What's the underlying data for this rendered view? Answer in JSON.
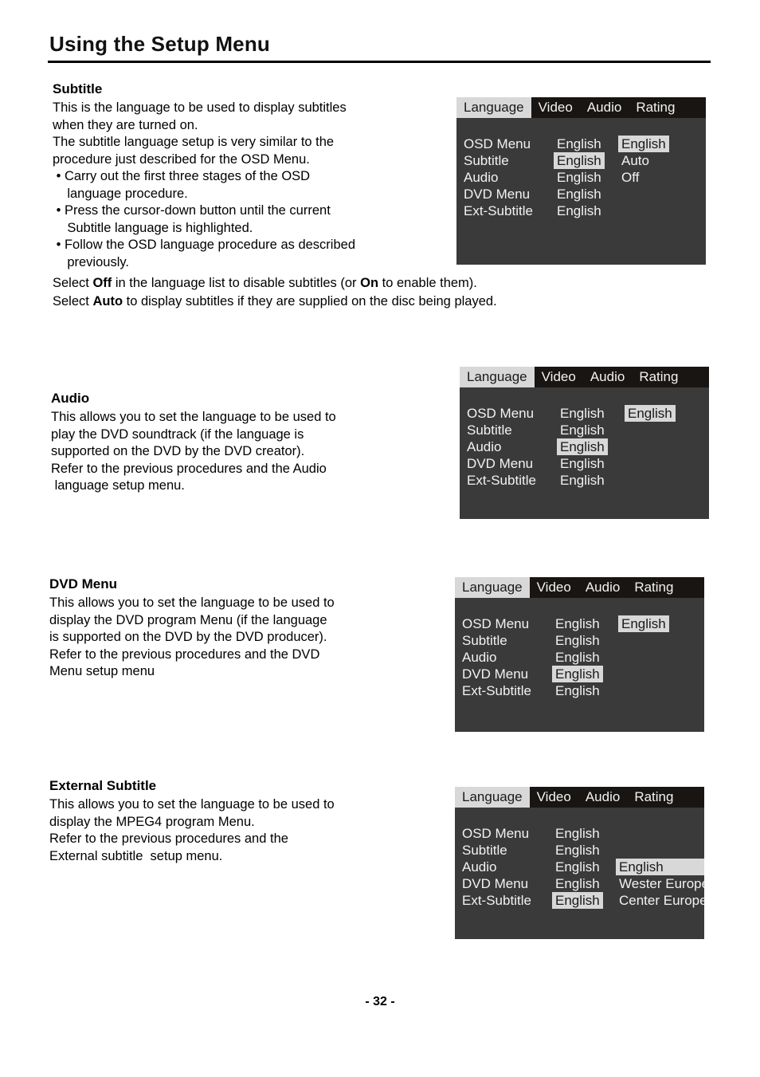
{
  "page": {
    "title": "Using the Setup Menu",
    "number": "- 32 -"
  },
  "sections": {
    "subtitle": {
      "heading": "Subtitle",
      "lines": [
        "This is the language to be used to display subtitles",
        "when they are turned on.",
        "The subtitle language setup is very similar to the",
        "procedure just described for the OSD Menu."
      ],
      "bullets": [
        " • Carry out the first three stages of the OSD",
        "    language procedure.",
        " • Press the cursor-down button until the current",
        "    Subtitle language is highlighted.",
        " • Follow the OSD language procedure as described",
        "    previously."
      ],
      "tail": [
        {
          "pre": "Select ",
          "bold": "Off",
          "mid": " in the language list to disable subtitles (or ",
          "bold2": "On",
          "post": " to enable them)."
        },
        {
          "pre": "Select ",
          "bold": "Auto",
          "mid": " to display subtitles if they are supplied on the disc being played.",
          "bold2": "",
          "post": ""
        }
      ]
    },
    "audio": {
      "heading": "Audio",
      "lines": [
        "This allows you to set the language to be used to",
        "play the DVD soundtrack (if the language is",
        "supported on the DVD by the DVD creator).",
        "Refer to the previous procedures and the Audio",
        " language setup menu."
      ]
    },
    "dvd_menu": {
      "heading": "DVD Menu",
      "lines": [
        "This allows you to set the language to be used to",
        "display the DVD program Menu (if the language",
        "is supported on the DVD by the DVD producer).",
        "Refer to the previous procedures and the DVD",
        "Menu setup menu"
      ]
    },
    "external_subtitle": {
      "heading": "External Subtitle",
      "lines": [
        "This allows you to set the language to be used to",
        "display the MPEG4 program Menu.",
        "Refer to the previous procedures and the",
        "External subtitle  setup menu."
      ]
    }
  },
  "osd_panels": {
    "tabs": [
      "Language",
      "Video",
      "Audio",
      "Rating"
    ],
    "active_tab": "Language",
    "row_labels": [
      "OSD Menu",
      "Subtitle",
      "Audio",
      "DVD Menu",
      "Ext-Subtitle"
    ],
    "subtitle_panel": {
      "values": [
        "English",
        "English",
        "English",
        "English",
        "English"
      ],
      "highlighted_row": "Subtitle",
      "popup": {
        "anchor_row": "OSD Menu",
        "options": [
          "English",
          "Auto",
          "Off"
        ],
        "selected": "English"
      }
    },
    "audio_panel": {
      "values": [
        "English",
        "English",
        "English",
        "English",
        "English"
      ],
      "highlighted_row": "Audio",
      "popup": {
        "anchor_row": "OSD Menu",
        "options": [
          "English"
        ],
        "selected": "English"
      }
    },
    "dvd_menu_panel": {
      "values": [
        "English",
        "English",
        "English",
        "English",
        "English"
      ],
      "highlighted_row": "DVD Menu",
      "popup": {
        "anchor_row": "OSD Menu",
        "options": [
          "English"
        ],
        "selected": "English"
      }
    },
    "ext_subtitle_panel": {
      "values": [
        "English",
        "English",
        "English",
        "English",
        "English"
      ],
      "highlighted_row": "Ext-Subtitle",
      "popup": {
        "anchor_row": "Audio",
        "options": [
          "English",
          "Wester Europe",
          "Center Europe"
        ],
        "selected": "English"
      }
    }
  },
  "colors": {
    "panel_body": "#3a3a3a",
    "panel_header": "#181512",
    "highlight": "#d8d8d8",
    "panel_text": "#f2f2f2"
  }
}
